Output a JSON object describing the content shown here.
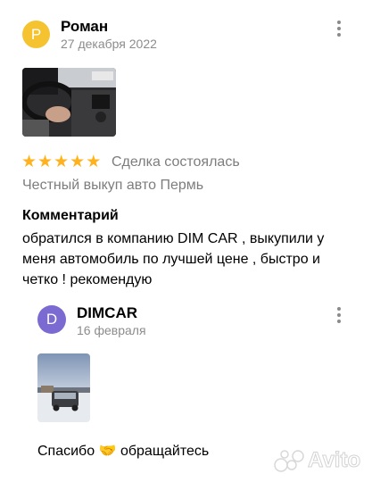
{
  "review": {
    "avatar_letter": "Р",
    "author": "Роман",
    "date": "27 декабря 2022",
    "rating": 5,
    "deal_status": "Сделка состоялась",
    "subject": "Честный выкуп авто Пермь",
    "comment_heading": "Комментарий",
    "comment_text": "обратился в компанию DIM CAR , выкупили у меня автомобиль по лучшей цене , быстро и четко ! рекомендую"
  },
  "reply": {
    "avatar_letter": "D",
    "author": "DIMCAR",
    "date": "16 февраля",
    "text_before": "Спасибо",
    "emoji": "🤝",
    "text_after": "обращайтесь"
  },
  "watermark": {
    "text": "Avito"
  },
  "colors": {
    "avatar_review": "#f5c330",
    "avatar_reply": "#7a6ad1",
    "star": "#ffb21e",
    "muted": "#7d7d7d"
  }
}
